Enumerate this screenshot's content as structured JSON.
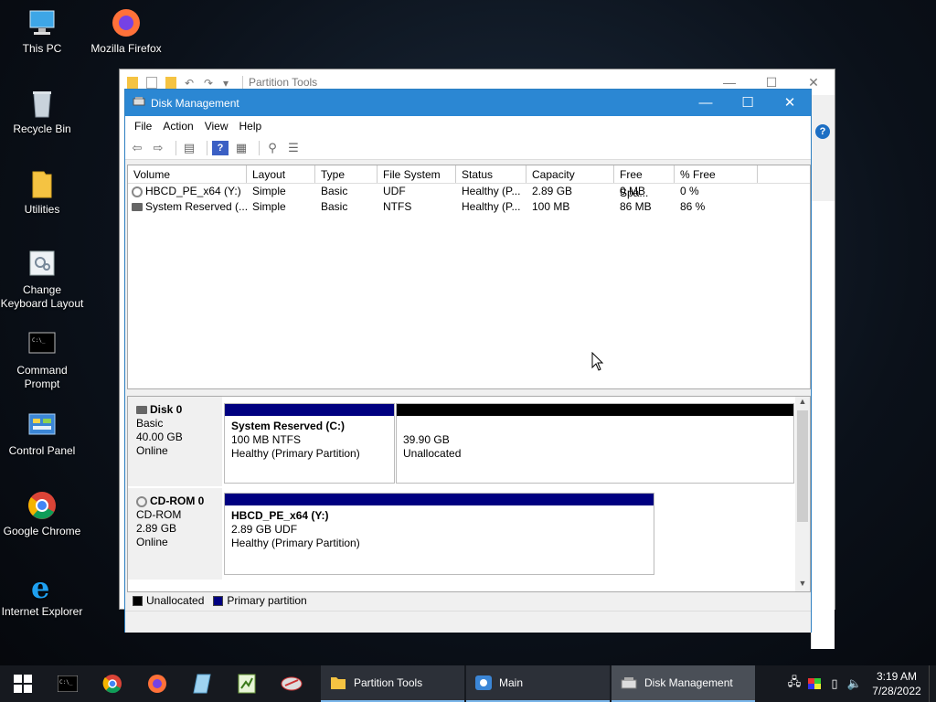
{
  "desktop": {
    "icons": [
      {
        "label": "This PC",
        "icon": "this-pc-icon"
      },
      {
        "label": "Mozilla Firefox",
        "icon": "firefox-icon"
      },
      {
        "label": "Recycle Bin",
        "icon": "recycle-bin-icon"
      },
      {
        "label": "Utilities",
        "icon": "folder-icon"
      },
      {
        "label": "Change Keyboard Layout",
        "icon": "keyboard-layout-icon"
      },
      {
        "label": "Command Prompt",
        "icon": "command-prompt-icon"
      },
      {
        "label": "Control Panel",
        "icon": "control-panel-icon"
      },
      {
        "label": "Google Chrome",
        "icon": "chrome-icon"
      },
      {
        "label": "Internet Explorer",
        "icon": "internet-explorer-icon"
      }
    ]
  },
  "bg_window": {
    "title": "Partition Tools"
  },
  "disk_mgmt": {
    "title": "Disk Management",
    "menu": [
      "File",
      "Action",
      "View",
      "Help"
    ],
    "columns": [
      "Volume",
      "Layout",
      "Type",
      "File System",
      "Status",
      "Capacity",
      "Free Spa...",
      "% Free"
    ],
    "volumes": [
      {
        "volume": "HBCD_PE_x64 (Y:)",
        "layout": "Simple",
        "type": "Basic",
        "fs": "UDF",
        "status": "Healthy (P...",
        "capacity": "2.89 GB",
        "free": "0 MB",
        "pct": "0 %"
      },
      {
        "volume": "System Reserved (...",
        "layout": "Simple",
        "type": "Basic",
        "fs": "NTFS",
        "status": "Healthy (P...",
        "capacity": "100 MB",
        "free": "86 MB",
        "pct": "86 %"
      }
    ],
    "disks": [
      {
        "name": "Disk 0",
        "kind": "Basic",
        "size": "40.00 GB",
        "state": "Online",
        "partitions": [
          {
            "name": "System Reserved  (C:)",
            "line1": "100 MB NTFS",
            "line2": "Healthy (Primary Partition)"
          },
          {
            "name": "",
            "line1": "39.90 GB",
            "line2": "Unallocated"
          }
        ]
      },
      {
        "name": "CD-ROM 0",
        "kind": "CD-ROM",
        "size": "2.89 GB",
        "state": "Online",
        "partitions": [
          {
            "name": "HBCD_PE_x64  (Y:)",
            "line1": "2.89 GB UDF",
            "line2": "Healthy (Primary Partition)"
          }
        ]
      }
    ],
    "legend": [
      {
        "label": "Unallocated",
        "color": "#000000"
      },
      {
        "label": "Primary partition",
        "color": "#000080"
      }
    ]
  },
  "taskbar": {
    "apps": [
      {
        "label": "Partition Tools",
        "icon": "folder-icon"
      },
      {
        "label": "Main",
        "icon": "main-app-icon"
      },
      {
        "label": "Disk Management",
        "icon": "disk-management-icon"
      }
    ],
    "clock": {
      "time": "3:19 AM",
      "date": "7/28/2022"
    }
  },
  "colors": {
    "accent": "#2b87d3",
    "primary_partition": "#000080",
    "unallocated": "#000000"
  }
}
